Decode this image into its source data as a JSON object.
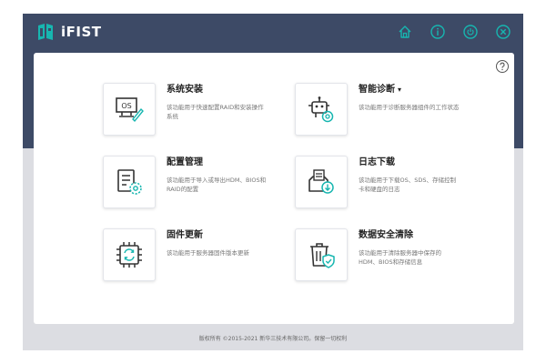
{
  "header": {
    "brand": "iFIST",
    "icons": [
      "home-icon",
      "info-icon",
      "power-icon",
      "close-icon"
    ]
  },
  "colors": {
    "header_bg": "#3d4a66",
    "accent": "#17b6b0",
    "icon_dark": "#333333"
  },
  "items": [
    {
      "title": "系统安装",
      "desc": "该功能用于快速配置RAID和安装操作系统",
      "icon": "os-install-icon"
    },
    {
      "title": "智能诊断",
      "caret": "▾",
      "desc": "该功能用于诊断服务器组件的工作状态",
      "icon": "diagnose-robot-icon"
    },
    {
      "title": "配置管理",
      "desc": "该功能用于导入或导出HDM、BIOS和RAID的配置",
      "icon": "config-settings-icon"
    },
    {
      "title": "日志下载",
      "desc": "该功能用于下载OS、SDS、存储控制卡和硬盘的日志",
      "icon": "log-download-icon"
    },
    {
      "title": "固件更新",
      "desc": "该功能用于服务器固件版本更新",
      "icon": "firmware-chip-icon"
    },
    {
      "title": "数据安全清除",
      "desc": "该功能用于清除服务器中保存的HDM、BIOS和存储信息",
      "icon": "secure-erase-icon"
    }
  ],
  "footer": {
    "text": "版权所有 ©2015-2021 新华三技术有限公司。保留一切权利"
  }
}
